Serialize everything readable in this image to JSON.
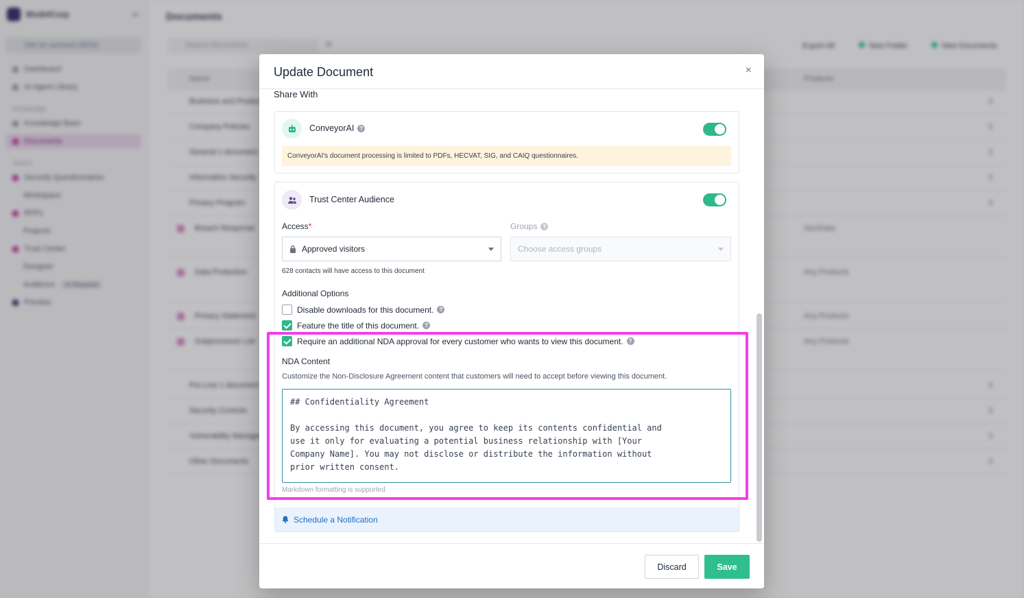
{
  "background": {
    "workspace_name": "ModelCorp",
    "sidebar_cta": "Get an account (90%)",
    "nav": [
      {
        "label": "Dashboard"
      },
      {
        "label": "AI Agent Library"
      }
    ],
    "knowledge_header": "Knowledge",
    "knowledge_items": [
      {
        "label": "Knowledge Base"
      },
      {
        "label": "Documents"
      }
    ],
    "teams_header": "Teams",
    "team_items": [
      {
        "label": "Security Questionnaires"
      },
      {
        "label": "Workspace"
      },
      {
        "label": "RFPs"
      },
      {
        "label": "Projects"
      },
      {
        "label": "Trust Center"
      },
      {
        "label": "Designer"
      },
      {
        "label": "Audience"
      },
      {
        "label": "Preview"
      }
    ],
    "audience_badge": "16 Requests",
    "page_title": "Documents",
    "search_placeholder": "Search documents",
    "toolbar": {
      "export": "Export All",
      "new_folder": "New Folder",
      "new_documents": "New Documents"
    },
    "table_headers": {
      "name": "Name",
      "products": "Products"
    },
    "rows": [
      {
        "name": "Business and Product",
        "num": "3",
        "products": ""
      },
      {
        "name": "Company Policies",
        "num": "3",
        "products": ""
      },
      {
        "name": "General  1 document",
        "num": "3",
        "products": ""
      },
      {
        "name": "Information Security",
        "num": "3",
        "products": ""
      },
      {
        "name": "Privacy Program",
        "num": "3",
        "products": ""
      },
      {
        "name": "Breach Response",
        "num": "",
        "products": "Sec/Data"
      },
      {
        "name": "Data Protection",
        "num": "",
        "products": "Any Products"
      },
      {
        "name": "Privacy Statement",
        "num": "",
        "products": "Any Products"
      },
      {
        "name": "Subprocessor List",
        "num": "",
        "products": "Any Products"
      },
      {
        "name": "Pro Line  1 document",
        "num": "3",
        "products": ""
      },
      {
        "name": "Security Controls",
        "num": "3",
        "products": ""
      },
      {
        "name": "Vulnerability Management",
        "num": "3",
        "products": ""
      },
      {
        "name": "Other Documents",
        "num": "3",
        "products": ""
      }
    ]
  },
  "modal": {
    "title": "Update Document",
    "close_label": "×",
    "share_with": "Share With",
    "conveyor_ai": {
      "name": "ConveyorAI",
      "enabled": true,
      "notice": "ConveyorAI's document processing is limited to PDFs, HECVAT, SIG, and CAIQ questionnaires."
    },
    "trust_center": {
      "name": "Trust Center Audience",
      "enabled": true,
      "access_label": "Access",
      "access_required_mark": "*",
      "access_value": "Approved visitors",
      "groups_label": "Groups",
      "groups_placeholder": "Choose access groups",
      "contacts_note": "628 contacts will have access to this document",
      "additional_options": "Additional Options",
      "options": [
        {
          "label": "Disable downloads for this document.",
          "checked": false
        },
        {
          "label": "Feature the title of this document.",
          "checked": true
        },
        {
          "label": "Require an additional NDA approval for every customer who wants to view this document.",
          "checked": true
        }
      ],
      "nda_title": "NDA Content",
      "nda_description": "Customize the Non-Disclosure Agreement content that customers will need to accept before viewing this document.",
      "nda_text": "## Confidentiality Agreement\n\nBy accessing this document, you agree to keep its contents confidential and\nuse it only for evaluating a potential business relationship with [Your\nCompany Name]. You may not disclose or distribute the information without\nprior written consent.",
      "markdown_hint": "Markdown formatting is supported"
    },
    "schedule_notification": "Schedule a Notification",
    "discard": "Discard",
    "save": "Save"
  },
  "colors": {
    "accent": "#2fb88a",
    "highlight": "#f43ee6",
    "notice_bg": "#fef3dc",
    "link": "#1f6fbf"
  },
  "icons": {
    "conveyor_ai": "robot-icon",
    "trust_center": "users-icon",
    "access": "lock-icon",
    "help": "question-circle-icon",
    "schedule": "bell-icon",
    "close": "close-icon"
  }
}
